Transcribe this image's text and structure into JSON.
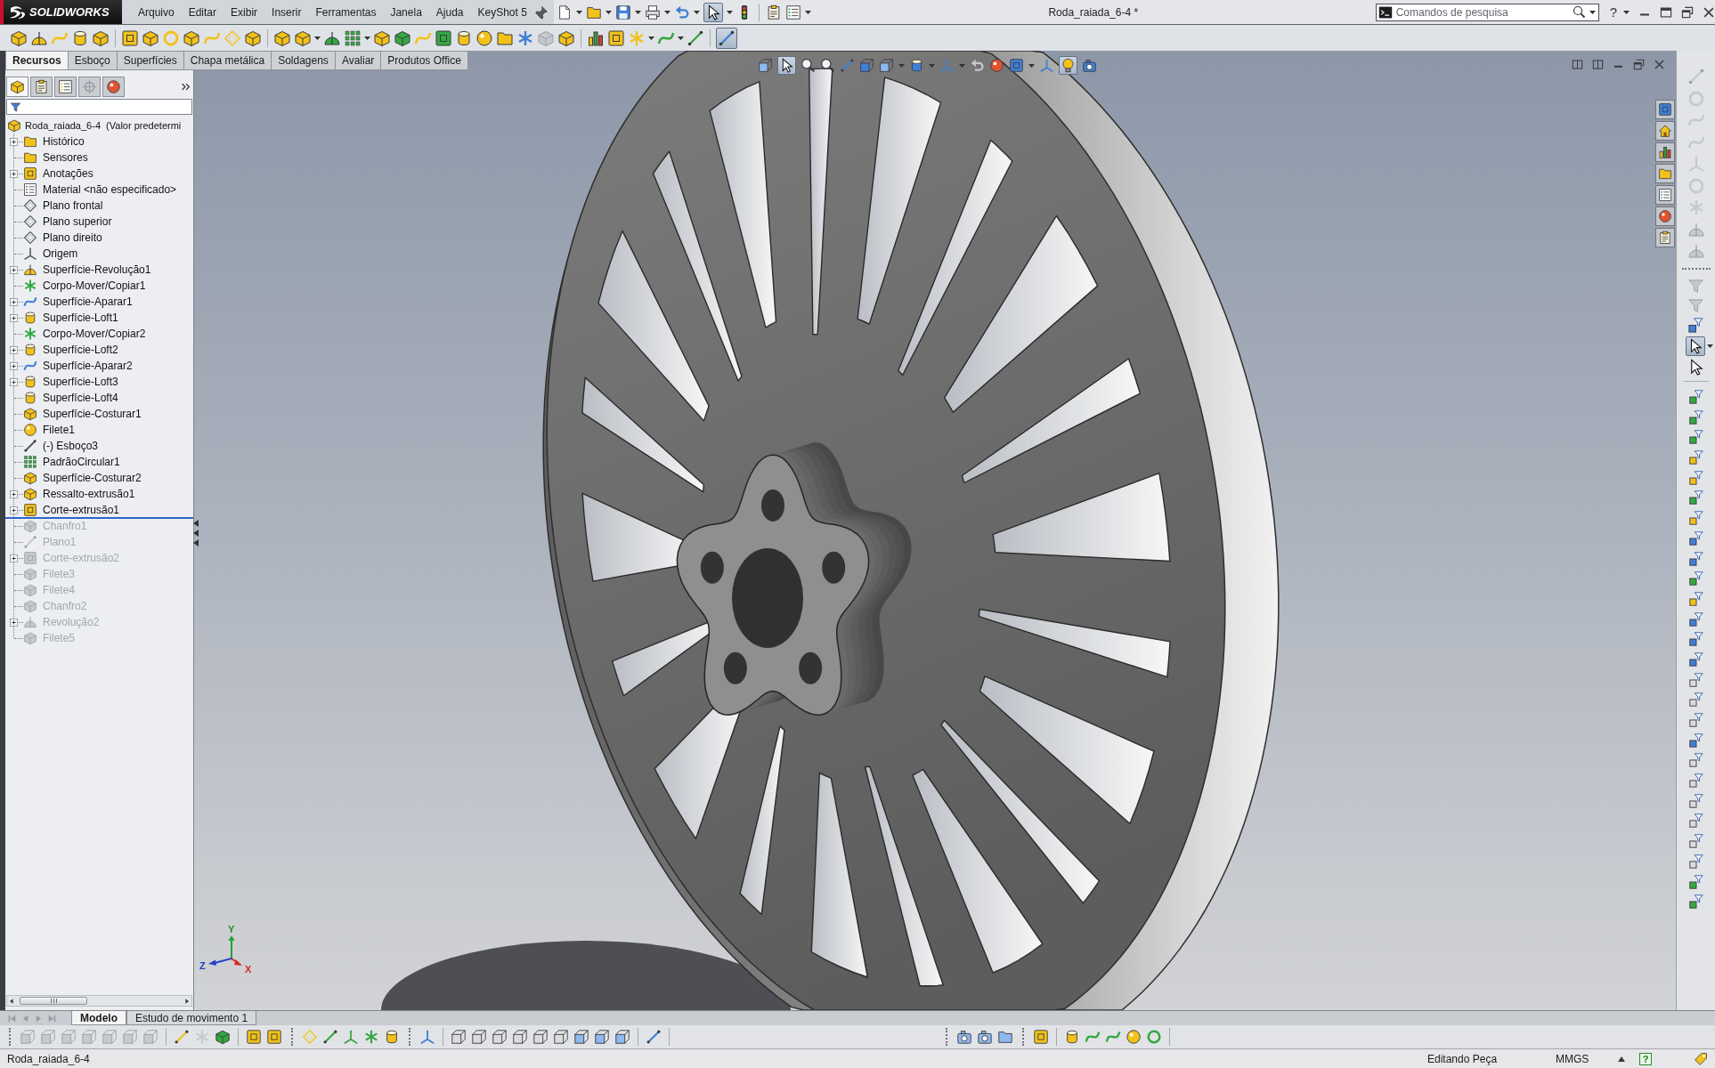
{
  "window": {
    "logo": "SOLIDWORKS",
    "title": "Roda_raiada_6-4 *",
    "help": "?"
  },
  "menu": [
    "Arquivo",
    "Editar",
    "Exibir",
    "Inserir",
    "Ferramentas",
    "Janela",
    "Ajuda",
    "KeyShot 5"
  ],
  "standard_toolbar": {
    "select_pressed": true
  },
  "search": {
    "placeholder": "Comandos de pesquisa"
  },
  "feature_toolbar": {
    "last_tool_pressed": true
  },
  "command_tabs": [
    {
      "label": "Recursos",
      "selected": true
    },
    {
      "label": "Esboço",
      "selected": false
    },
    {
      "label": "Superfícies",
      "selected": false
    },
    {
      "label": "Chapa metálica",
      "selected": false
    },
    {
      "label": "Soldagens",
      "selected": false
    },
    {
      "label": "Avaliar",
      "selected": false
    },
    {
      "label": "Produtos Office",
      "selected": false
    }
  ],
  "panel_tabs": [
    {
      "selected": true,
      "disabled": false
    },
    {
      "selected": false,
      "disabled": false
    },
    {
      "selected": false,
      "disabled": false
    },
    {
      "selected": false,
      "disabled": true
    },
    {
      "selected": false,
      "disabled": false
    }
  ],
  "feature_tree": {
    "root": "Roda_raiada_6-4  (Valor predetermi",
    "items": [
      {
        "label": "Histórico",
        "expandable": true,
        "rolled_back": false
      },
      {
        "label": "Sensores",
        "expandable": false,
        "rolled_back": false
      },
      {
        "label": "Anotações",
        "expandable": true,
        "rolled_back": false
      },
      {
        "label": "Material <não especificado>",
        "expandable": false,
        "rolled_back": false
      },
      {
        "label": "Plano frontal",
        "expandable": false,
        "rolled_back": false
      },
      {
        "label": "Plano superior",
        "expandable": false,
        "rolled_back": false
      },
      {
        "label": "Plano direito",
        "expandable": false,
        "rolled_back": false
      },
      {
        "label": "Origem",
        "expandable": false,
        "rolled_back": false
      },
      {
        "label": "Superfície-Revolução1",
        "expandable": true,
        "rolled_back": false
      },
      {
        "label": "Corpo-Mover/Copiar1",
        "expandable": false,
        "rolled_back": false
      },
      {
        "label": "Superfície-Aparar1",
        "expandable": true,
        "rolled_back": false
      },
      {
        "label": "Superfície-Loft1",
        "expandable": true,
        "rolled_back": false
      },
      {
        "label": "Corpo-Mover/Copiar2",
        "expandable": false,
        "rolled_back": false
      },
      {
        "label": "Superfície-Loft2",
        "expandable": true,
        "rolled_back": false
      },
      {
        "label": "Superfície-Aparar2",
        "expandable": true,
        "rolled_back": false
      },
      {
        "label": "Superfície-Loft3",
        "expandable": true,
        "rolled_back": false
      },
      {
        "label": "Superfície-Loft4",
        "expandable": false,
        "rolled_back": false
      },
      {
        "label": "Superfície-Costurar1",
        "expandable": false,
        "rolled_back": false
      },
      {
        "label": "Filete1",
        "expandable": false,
        "rolled_back": false
      },
      {
        "label": "(-) Esboço3",
        "expandable": false,
        "rolled_back": false
      },
      {
        "label": "PadrãoCircular1",
        "expandable": false,
        "rolled_back": false
      },
      {
        "label": "Superfície-Costurar2",
        "expandable": false,
        "rolled_back": false
      },
      {
        "label": "Ressalto-extrusão1",
        "expandable": true,
        "rolled_back": false
      },
      {
        "label": "Corte-extrusão1",
        "expandable": true,
        "rolled_back": false
      },
      {
        "label": "Chanfro1",
        "expandable": false,
        "rolled_back": true
      },
      {
        "label": "Plano1",
        "expandable": false,
        "rolled_back": true
      },
      {
        "label": "Corte-extrusão2",
        "expandable": true,
        "rolled_back": true
      },
      {
        "label": "Filete3",
        "expandable": false,
        "rolled_back": true
      },
      {
        "label": "Filete4",
        "expandable": false,
        "rolled_back": true
      },
      {
        "label": "Chanfro2",
        "expandable": false,
        "rolled_back": true
      },
      {
        "label": "Revolução2",
        "expandable": true,
        "rolled_back": true
      },
      {
        "label": "Filete5",
        "expandable": false,
        "rolled_back": true
      }
    ]
  },
  "view_toolbar": {
    "select_pressed": true,
    "lighting_pressed": true
  },
  "triad": {
    "x": "X",
    "y": "Y",
    "z": "Z"
  },
  "filter_toolbar": {
    "select_pressed": true
  },
  "bottom_tabs": [
    {
      "label": "Modelo",
      "selected": true
    },
    {
      "label": "Estudo de movimento 1",
      "selected": false
    }
  ],
  "status_bar": {
    "document": "Roda_raiada_6-4",
    "mode": "Editando Peça",
    "units": "MMGS",
    "help": "?"
  }
}
